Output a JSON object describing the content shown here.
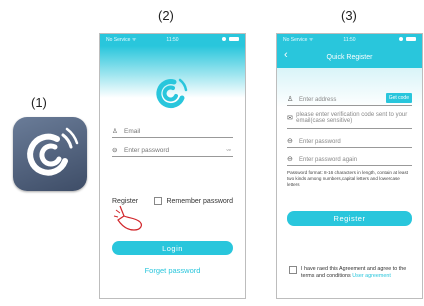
{
  "steps": [
    "(1)",
    "(2)",
    "(3)"
  ],
  "colors": {
    "accent": "#29c6dc",
    "icon_bg": "#4c5b76"
  },
  "status": {
    "carrier": "No Service",
    "wifi": "wifi-icon",
    "time": "11:50"
  },
  "login": {
    "email_placeholder": "Email",
    "password_placeholder": "Enter password",
    "register_link": "Register",
    "remember_label": "Remember password",
    "login_button": "Login",
    "forget_link": "Forget password"
  },
  "register": {
    "title": "Quick Register",
    "address_placeholder": "Enter address",
    "get_code_button": "Get code",
    "verification_placeholder": "please enter verification code sent to your email(case sensitive)",
    "password_placeholder": "Enter password",
    "password_again_placeholder": "Enter password again",
    "password_hint": "Password format: 8-16 characters in length, contain at least two kinds among numbers,capital letters and lowercase letters",
    "register_button": "Register",
    "agree_text": "I have raed this Agreement and agree to the terms and conditions",
    "agreement_link": "User agreement"
  }
}
